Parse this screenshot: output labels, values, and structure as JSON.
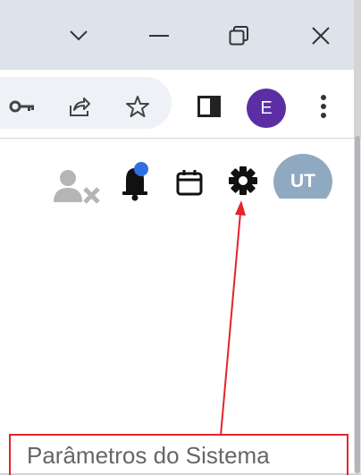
{
  "window": {
    "controls": [
      "chevron-down",
      "minimize",
      "restore",
      "close"
    ]
  },
  "toolbar": {
    "icons": [
      "key-icon",
      "share-icon",
      "star-icon",
      "side-panel-icon",
      "kebab-menu-icon"
    ],
    "profile_initial": "E",
    "profile_color": "#5b2ea6"
  },
  "app_header": {
    "icons": [
      "user-remove-icon",
      "bell-icon",
      "calendar-icon",
      "gear-icon"
    ],
    "notification_dot_color": "#2f6fe0",
    "avatar_initials": "UT",
    "avatar_color": "#8fa9c1"
  },
  "menu": {
    "system_parameters_label": "Parâmetros do Sistema"
  },
  "annotation": {
    "color": "#e3242b"
  }
}
